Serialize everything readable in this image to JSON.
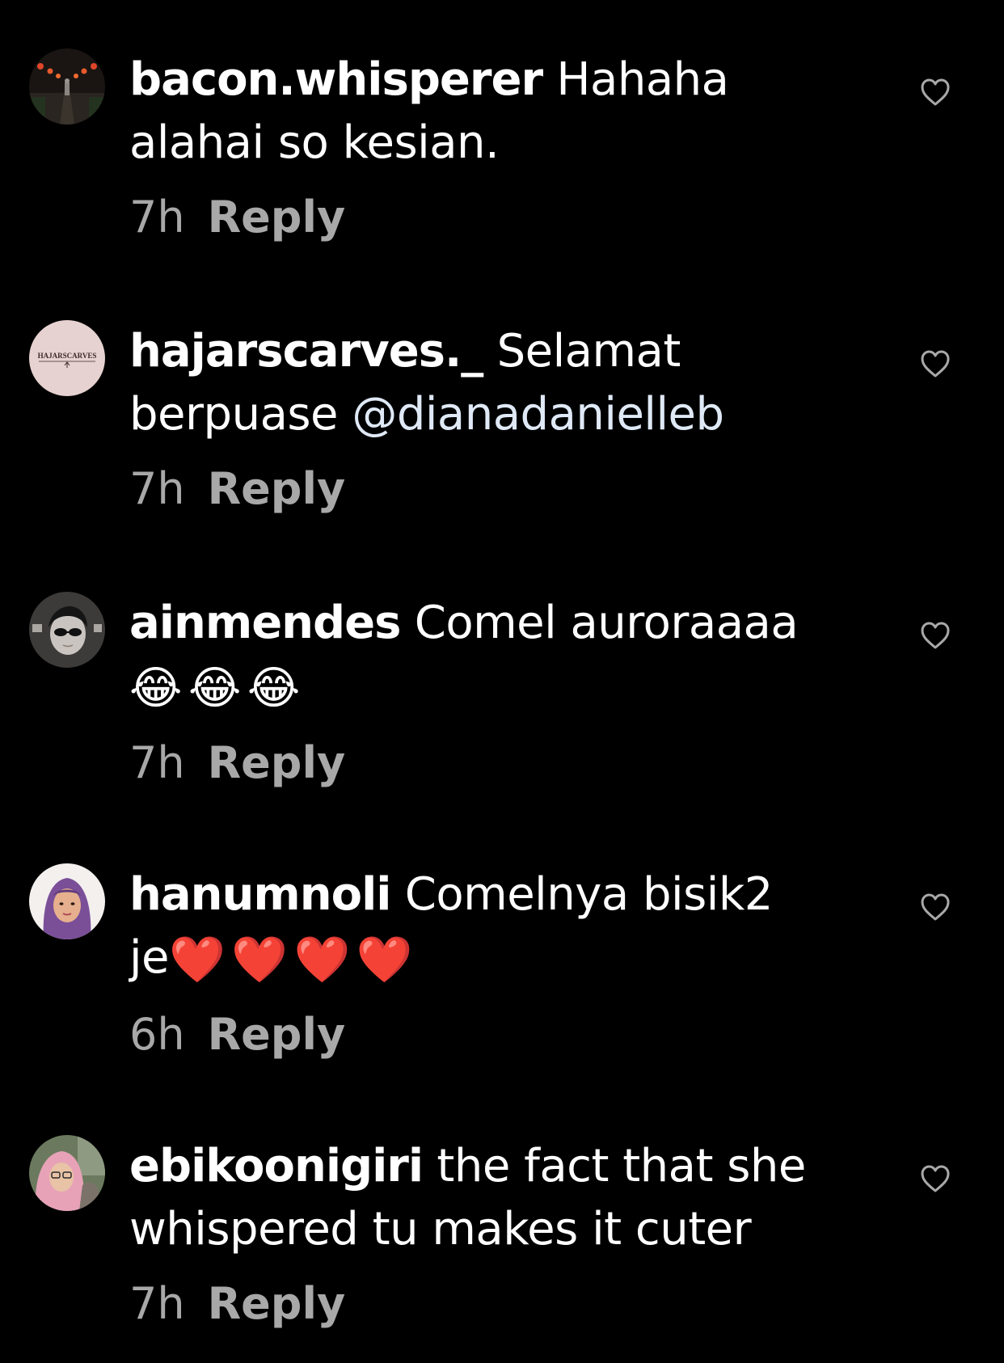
{
  "colors": {
    "background": "#000000",
    "text": "#ffffff",
    "meta": "#a8a8a8",
    "mention": "#dfe9f6"
  },
  "comments": [
    {
      "username": "bacon.whisperer",
      "text": "Hahaha alahai so kesian.",
      "time": "7h",
      "reply": "Reply",
      "avatar_icon": "lantern-street-photo-avatar",
      "like_icon": "heart-outline-icon"
    },
    {
      "username": "hajarscarves._",
      "text": "Selamat berpuase",
      "mention": "@dianadanielleb",
      "time": "7h",
      "reply": "Reply",
      "avatar_text": "HAJARSCARVES",
      "like_icon": "heart-outline-icon"
    },
    {
      "username": "ainmendes",
      "text": "Comel auroraaaa",
      "emojis": [
        "😂",
        "😂",
        "😂"
      ],
      "time": "7h",
      "reply": "Reply",
      "avatar_icon": "sunglasses-person-avatar",
      "like_icon": "heart-outline-icon"
    },
    {
      "username": "hanumnoli",
      "text": "Comelnya bisik2 je",
      "emojis": [
        "❤️",
        "❤️",
        "❤️",
        "❤️"
      ],
      "time": "6h",
      "reply": "Reply",
      "avatar_icon": "purple-hijab-person-avatar",
      "like_icon": "heart-outline-icon"
    },
    {
      "username": "ebikoonigiri",
      "text": "the fact that she whispered tu makes it cuter",
      "time": "7h",
      "reply": "Reply",
      "avatar_icon": "pink-hijab-person-avatar",
      "like_icon": "heart-outline-icon"
    }
  ]
}
